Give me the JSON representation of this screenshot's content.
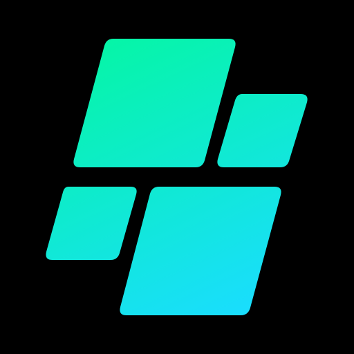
{
  "logo": {
    "icon_name": "four-tile-parallelogram-logo-icon",
    "background_color": "#000000",
    "gradient_start_color": "#06F5A8",
    "gradient_end_color": "#1ADDFF",
    "tile_count": 4
  }
}
